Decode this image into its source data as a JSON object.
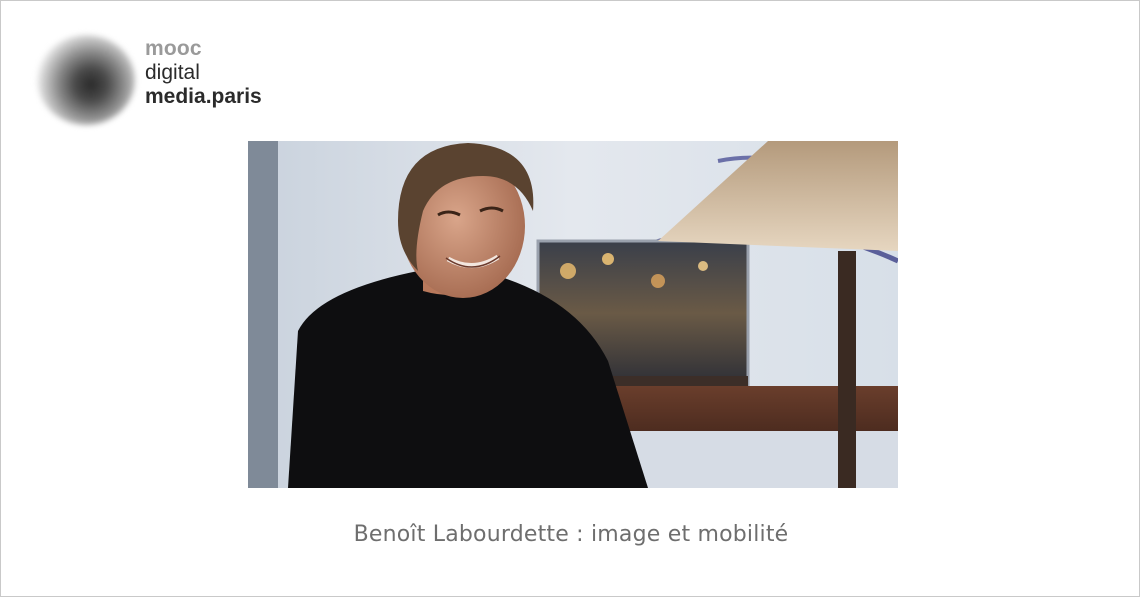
{
  "logo": {
    "line1": "mooc",
    "line2": "digital",
    "line3": "media.paris"
  },
  "video": {
    "thumbnail": "interview-still-man-smiling"
  },
  "caption": "Benoît Labourdette : image et mobilité"
}
